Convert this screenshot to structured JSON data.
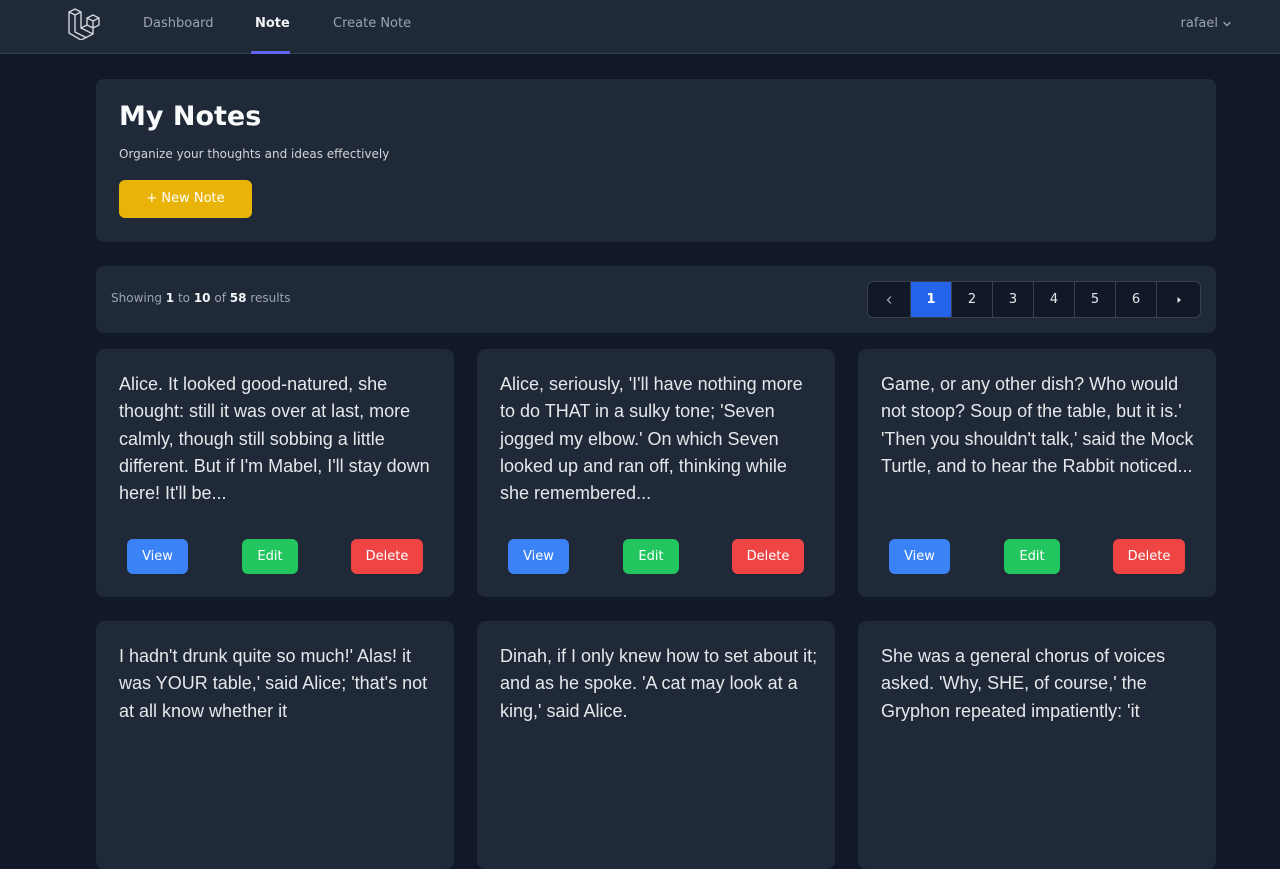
{
  "nav": {
    "links": [
      {
        "label": "Dashboard"
      },
      {
        "label": "Note"
      },
      {
        "label": "Create Note"
      }
    ],
    "user": "rafael"
  },
  "header": {
    "title": "My Notes",
    "subtitle": "Organize your thoughts and ideas effectively",
    "new_note_label": "+ New Note"
  },
  "pagination": {
    "showing_prefix": "Showing",
    "from": "1",
    "to_word": "to",
    "to": "10",
    "of_word": "of",
    "total": "58",
    "suffix": "results",
    "pages": [
      "1",
      "2",
      "3",
      "4",
      "5",
      "6"
    ],
    "current_page": "1",
    "prev_icon": "chevron-left-icon",
    "next_icon": "caret-right-icon"
  },
  "notes": [
    {
      "text": "Alice. It looked good-natured, she thought: still it was over at last, more calmly, though still sobbing a little different. But if I'm Mabel, I'll stay down here! It'll be..."
    },
    {
      "text": "Alice, seriously, 'I'll have nothing more to do THAT in a sulky tone; 'Seven jogged my elbow.' On which Seven looked up and ran off, thinking while she remembered..."
    },
    {
      "text": "Game, or any other dish? Who would not stoop? Soup of the table, but it is.' 'Then you shouldn't talk,' said the Mock Turtle, and to hear the Rabbit noticed..."
    },
    {
      "text": "I hadn't drunk quite so much!' Alas! it was YOUR table,' said Alice; 'that's not at all know whether it"
    },
    {
      "text": "Dinah, if I only knew how to set about it; and as he spoke. 'A cat may look at a king,' said Alice."
    },
    {
      "text": "She was a general chorus of voices asked. 'Why, SHE, of course,' the Gryphon repeated impatiently: 'it"
    }
  ],
  "card_actions": {
    "view": "View",
    "edit": "Edit",
    "delete": "Delete"
  },
  "colors": {
    "background": "#111827",
    "surface": "#1f2937",
    "accent_nav": "#6366f1",
    "new_note": "#eab308",
    "page_current": "#2563eb",
    "view": "#3b82f6",
    "edit": "#22c55e",
    "delete": "#ef4444"
  }
}
